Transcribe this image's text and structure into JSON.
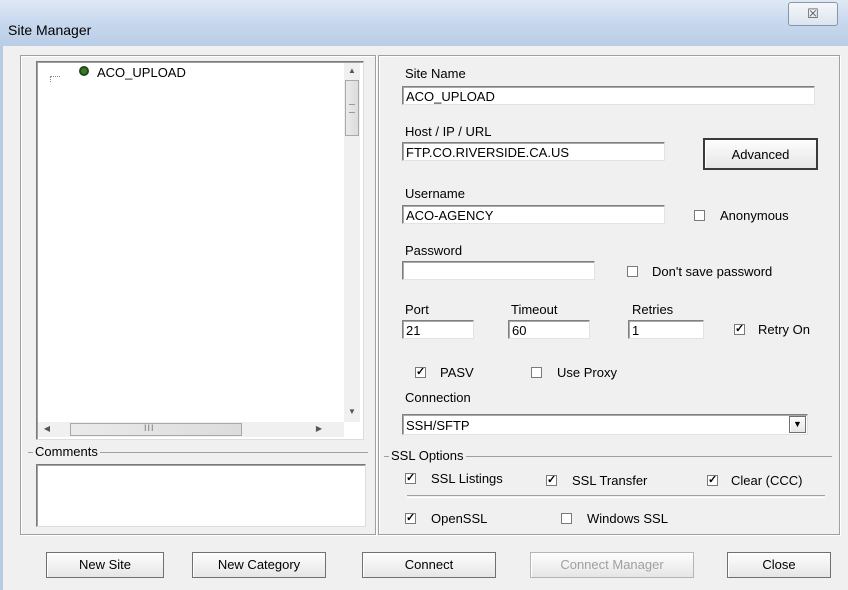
{
  "window": {
    "title": "Site Manager",
    "close_glyph": "☒"
  },
  "tree": {
    "items": [
      {
        "label": "ACO_UPLOAD",
        "icon": "site-dot-icon"
      }
    ],
    "hscroll_grip": "III"
  },
  "comments": {
    "label": "Comments",
    "value": ""
  },
  "site_name": {
    "label": "Site Name",
    "value": "ACO_UPLOAD"
  },
  "host": {
    "label": "Host / IP / URL",
    "value": "FTP.CO.RIVERSIDE.CA.US"
  },
  "advanced_label": "Advanced",
  "username": {
    "label": "Username",
    "value": "ACO-AGENCY"
  },
  "anonymous": {
    "label": "Anonymous",
    "checked": false
  },
  "password": {
    "label": "Password",
    "value": ""
  },
  "dont_save_password": {
    "label": "Don't save password",
    "checked": false
  },
  "port": {
    "label": "Port",
    "value": "21"
  },
  "timeout": {
    "label": "Timeout",
    "value": "60"
  },
  "retries": {
    "label": "Retries",
    "value": "1"
  },
  "retry_on": {
    "label": "Retry On",
    "checked": true
  },
  "pasv": {
    "label": "PASV",
    "checked": true
  },
  "use_proxy": {
    "label": "Use Proxy",
    "checked": false
  },
  "connection": {
    "label": "Connection",
    "value": "SSH/SFTP"
  },
  "ssl": {
    "label": "SSL Options",
    "listings": {
      "label": "SSL Listings",
      "checked": true
    },
    "transfer": {
      "label": "SSL Transfer",
      "checked": true
    },
    "clear_ccc": {
      "label": "Clear (CCC)",
      "checked": true
    },
    "openssl": {
      "label": "OpenSSL",
      "checked": true
    },
    "windows_ssl": {
      "label": "Windows SSL",
      "checked": false
    }
  },
  "buttons": {
    "new_site": "New Site",
    "new_category": "New Category",
    "connect": "Connect",
    "connect_manager": "Connect Manager",
    "close": "Close"
  },
  "check_glyph": "✓"
}
